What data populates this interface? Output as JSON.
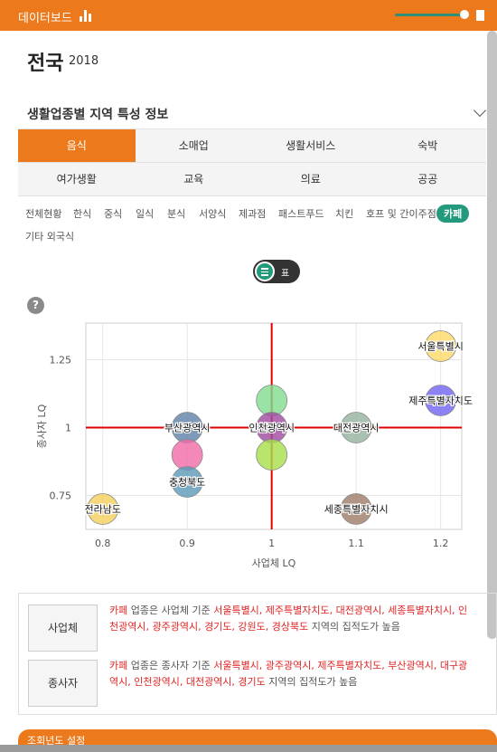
{
  "header": {
    "title": "데이터보드"
  },
  "region": {
    "name": "전국",
    "year": "2018"
  },
  "section": {
    "title": "생활업종별 지역 특성 정보"
  },
  "tabs_row1": [
    "음식",
    "소매업",
    "생활서비스",
    "숙박"
  ],
  "tabs_row2": [
    "여가생활",
    "교육",
    "의료",
    "공공"
  ],
  "active_tab": "음식",
  "subcategories": [
    "전체현황",
    "한식",
    "중식",
    "일식",
    "분식",
    "서양식",
    "제과점",
    "패스트푸드",
    "치킨",
    "호프 및 간이주점",
    "카페",
    "기타 외국식"
  ],
  "active_subcategory": "카페",
  "view_toggle": {
    "label": "표"
  },
  "help": {
    "label": "?"
  },
  "chart_data": {
    "type": "scatter",
    "xlabel": "사업체 LQ",
    "ylabel": "종사자 LQ",
    "xlim": [
      0.78,
      1.225
    ],
    "ylim": [
      0.625,
      1.385
    ],
    "xticks": [
      0.8,
      0.9,
      1,
      1.1,
      1.2
    ],
    "yticks": [
      0.75,
      1,
      1.25
    ],
    "xtick_labels": [
      "0.8",
      "0.9",
      "1",
      "1.1",
      "1.2"
    ],
    "ytick_labels": [
      "0.75",
      "1",
      "1.25"
    ],
    "reference_lines": {
      "x": 1,
      "y": 1,
      "color": "#e00000"
    },
    "grid": true,
    "points": [
      {
        "label": "서울특별시",
        "x": 1.2,
        "y": 1.3,
        "color": "#ffd966"
      },
      {
        "label": "제주특별자치도",
        "x": 1.2,
        "y": 1.1,
        "color": "#6f63f0"
      },
      {
        "label": "대전광역시",
        "x": 1.1,
        "y": 1.0,
        "color": "#95b29f"
      },
      {
        "label": "세종특별자치시",
        "x": 1.1,
        "y": 0.7,
        "color": "#9e7a66"
      },
      {
        "label": "",
        "x": 1.0,
        "y": 1.1,
        "color": "#7fdc8f"
      },
      {
        "label": "인천광역시",
        "x": 1.0,
        "y": 1.0,
        "color": "#a04aa0"
      },
      {
        "label": "",
        "x": 1.0,
        "y": 0.9,
        "color": "#a6de4a"
      },
      {
        "label": "부산광역시",
        "x": 0.9,
        "y": 1.0,
        "color": "#5f7fa8"
      },
      {
        "label": "",
        "x": 0.9,
        "y": 0.9,
        "color": "#f06aa8"
      },
      {
        "label": "충청북도",
        "x": 0.9,
        "y": 0.8,
        "color": "#5a9ab8"
      },
      {
        "label": "전라남도",
        "x": 0.8,
        "y": 0.7,
        "color": "#f5cf5b"
      }
    ]
  },
  "info": {
    "business": {
      "button": "사업체",
      "line1_prefix": "카페",
      "line1_mid": " 업종은 사업체 기준 ",
      "line1_regions": "서울특별시, 제주특별자치도, 대전광역시, 세종특별자치시, 인",
      "line2_regions": "천광역시, 광주광역시, 경기도, 강원도, 경상북도",
      "line2_suffix": " 지역의 집적도가 높음"
    },
    "worker": {
      "button": "종사자",
      "line1_prefix": "카페",
      "line1_mid": " 업종은 종사자 기준 ",
      "line1_regions": "서울특별시, 광주광역시, 제주특별자치도, 부산광역시, 대구광",
      "line2_regions": "역시, 인천광역시, 대전광역시, 경기도",
      "line2_suffix": " 지역의 집적도가 높음"
    }
  },
  "footer": {
    "title": "조회년도 설정"
  }
}
